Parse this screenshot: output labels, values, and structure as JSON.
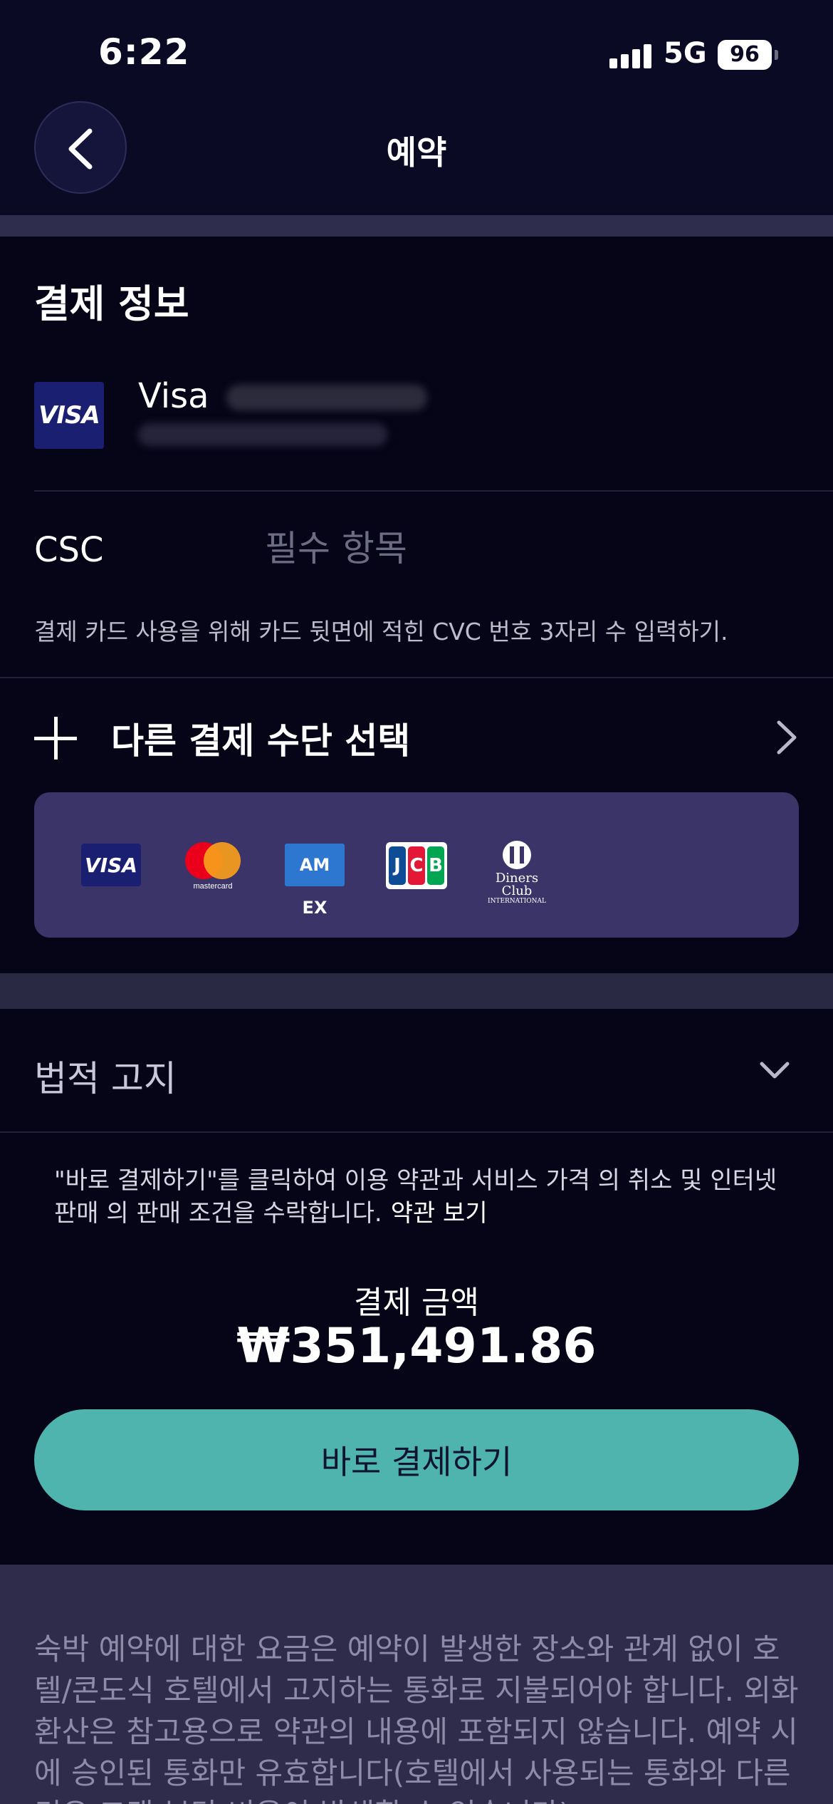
{
  "status_bar": {
    "time": "6:22",
    "network": "5G",
    "battery": "96"
  },
  "header": {
    "title": "예약"
  },
  "payment": {
    "section_title": "결제 정보",
    "card": {
      "brand": "Visa",
      "logo_text": "VISA"
    },
    "csc": {
      "label": "CSC",
      "placeholder": "필수 항목",
      "hint": "결제 카드 사용을 위해 카드 뒷면에 적힌 CVC 번호 3자리 수 입력하기."
    },
    "other_method_label": "다른 결제 수단 선택",
    "accepted_brands": {
      "visa": "VISA",
      "mastercard": "mastercard",
      "amex": "AM EX",
      "jcb": [
        "J",
        "C",
        "B"
      ],
      "diners": "Diners Club",
      "diners_sub": "INTERNATIONAL"
    }
  },
  "legal": {
    "title": "법적 고지",
    "notice": "\"바로 결제하기\"를 클릭하여 이용 약관과 서비스 가격 의 취소 및 인터넷 판매 의 판매 조건을 수락합니다.",
    "terms_link": "약관 보기",
    "total_label": "결제 금액",
    "total_amount": "₩351,491.86",
    "pay_button": "바로 결제하기"
  },
  "footer": {
    "text": "숙박 예약에 대한 요금은 예약이 발생한 장소와 관계 없이 호텔/콘도식 호텔에서 고지하는 통화로 지불되어야 합니다. 외화 환산은 참고용으로 약관의 내용에 포함되지 않습니다. 예약 시에 승인된 통화만 유효합니다(호텔에서 사용되는 통화와 다른 경우 고객 부담 비용이 발생할 수 있습니다)."
  },
  "icons": [
    "back-arrow-icon",
    "plus-icon",
    "chevron-right-icon",
    "chevron-down-icon"
  ],
  "colors": {
    "background": "#0b0a24",
    "brands_box": "#3a3468",
    "pay_button": "#4fb3ae"
  }
}
